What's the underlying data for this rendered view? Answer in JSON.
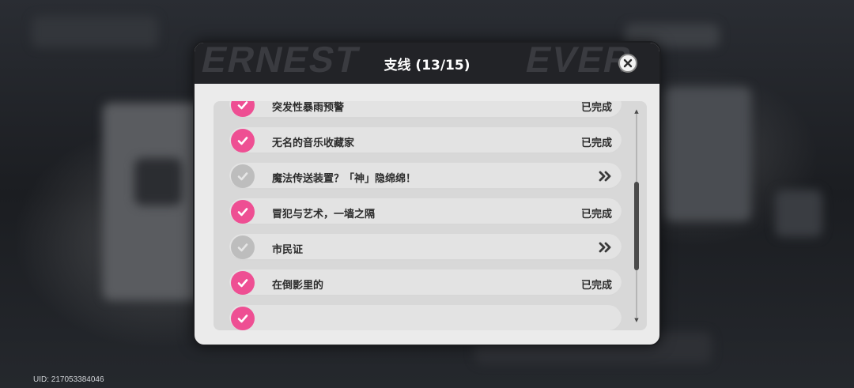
{
  "uid_text": "UID: 217053384046",
  "dialog": {
    "title": "支线 (13/15)",
    "close_icon": "close-icon",
    "header_deco": [
      "ERNEST",
      "EVER"
    ]
  },
  "colors": {
    "accent_done": "#ee4f93",
    "pending": "#bdbdbd"
  },
  "tasks": [
    {
      "label": "突发性暴雨预警",
      "status": "已完成",
      "done": true
    },
    {
      "label": "无名的音乐收藏家",
      "status": "已完成",
      "done": true
    },
    {
      "label": "魔法传送装置？「神」隐绵绵！",
      "status": "",
      "done": false
    },
    {
      "label": "冒犯与艺术，一墙之隔",
      "status": "已完成",
      "done": true
    },
    {
      "label": "市民证",
      "status": "",
      "done": false
    },
    {
      "label": "在倒影里的",
      "status": "已完成",
      "done": true
    },
    {
      "label": "",
      "status": "",
      "done": true
    }
  ]
}
